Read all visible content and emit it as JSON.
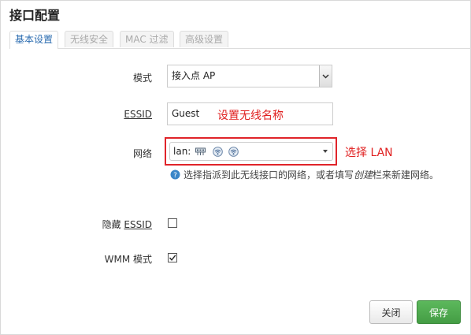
{
  "dialog": {
    "title": "接口配置"
  },
  "tabs": [
    {
      "label": "基本设置",
      "active": true
    },
    {
      "label": "无线安全",
      "active": false
    },
    {
      "label": "MAC 过滤",
      "active": false
    },
    {
      "label": "高级设置",
      "active": false
    }
  ],
  "form": {
    "mode": {
      "label": "模式",
      "value": "接入点 AP"
    },
    "essid": {
      "label": "ESSID",
      "value": "Guest",
      "annotation": "设置无线名称"
    },
    "network": {
      "label": "网络",
      "value_prefix": "lan:",
      "annotation": "选择 LAN",
      "hint_prefix": "选择指派到此无线接口的网络，或者填写",
      "hint_emph": "创建",
      "hint_suffix": "栏来新建网络。"
    },
    "hide_essid": {
      "label_prefix": "隐藏 ",
      "label_u": "ESSID",
      "checked": false
    },
    "wmm": {
      "label": "WMM 模式",
      "checked": true
    }
  },
  "buttons": {
    "close": "关闭",
    "save": "保存"
  },
  "colors": {
    "annotation": "#e02020",
    "save_button": "#5cb85c",
    "active_tab": "#2b6cb0"
  }
}
